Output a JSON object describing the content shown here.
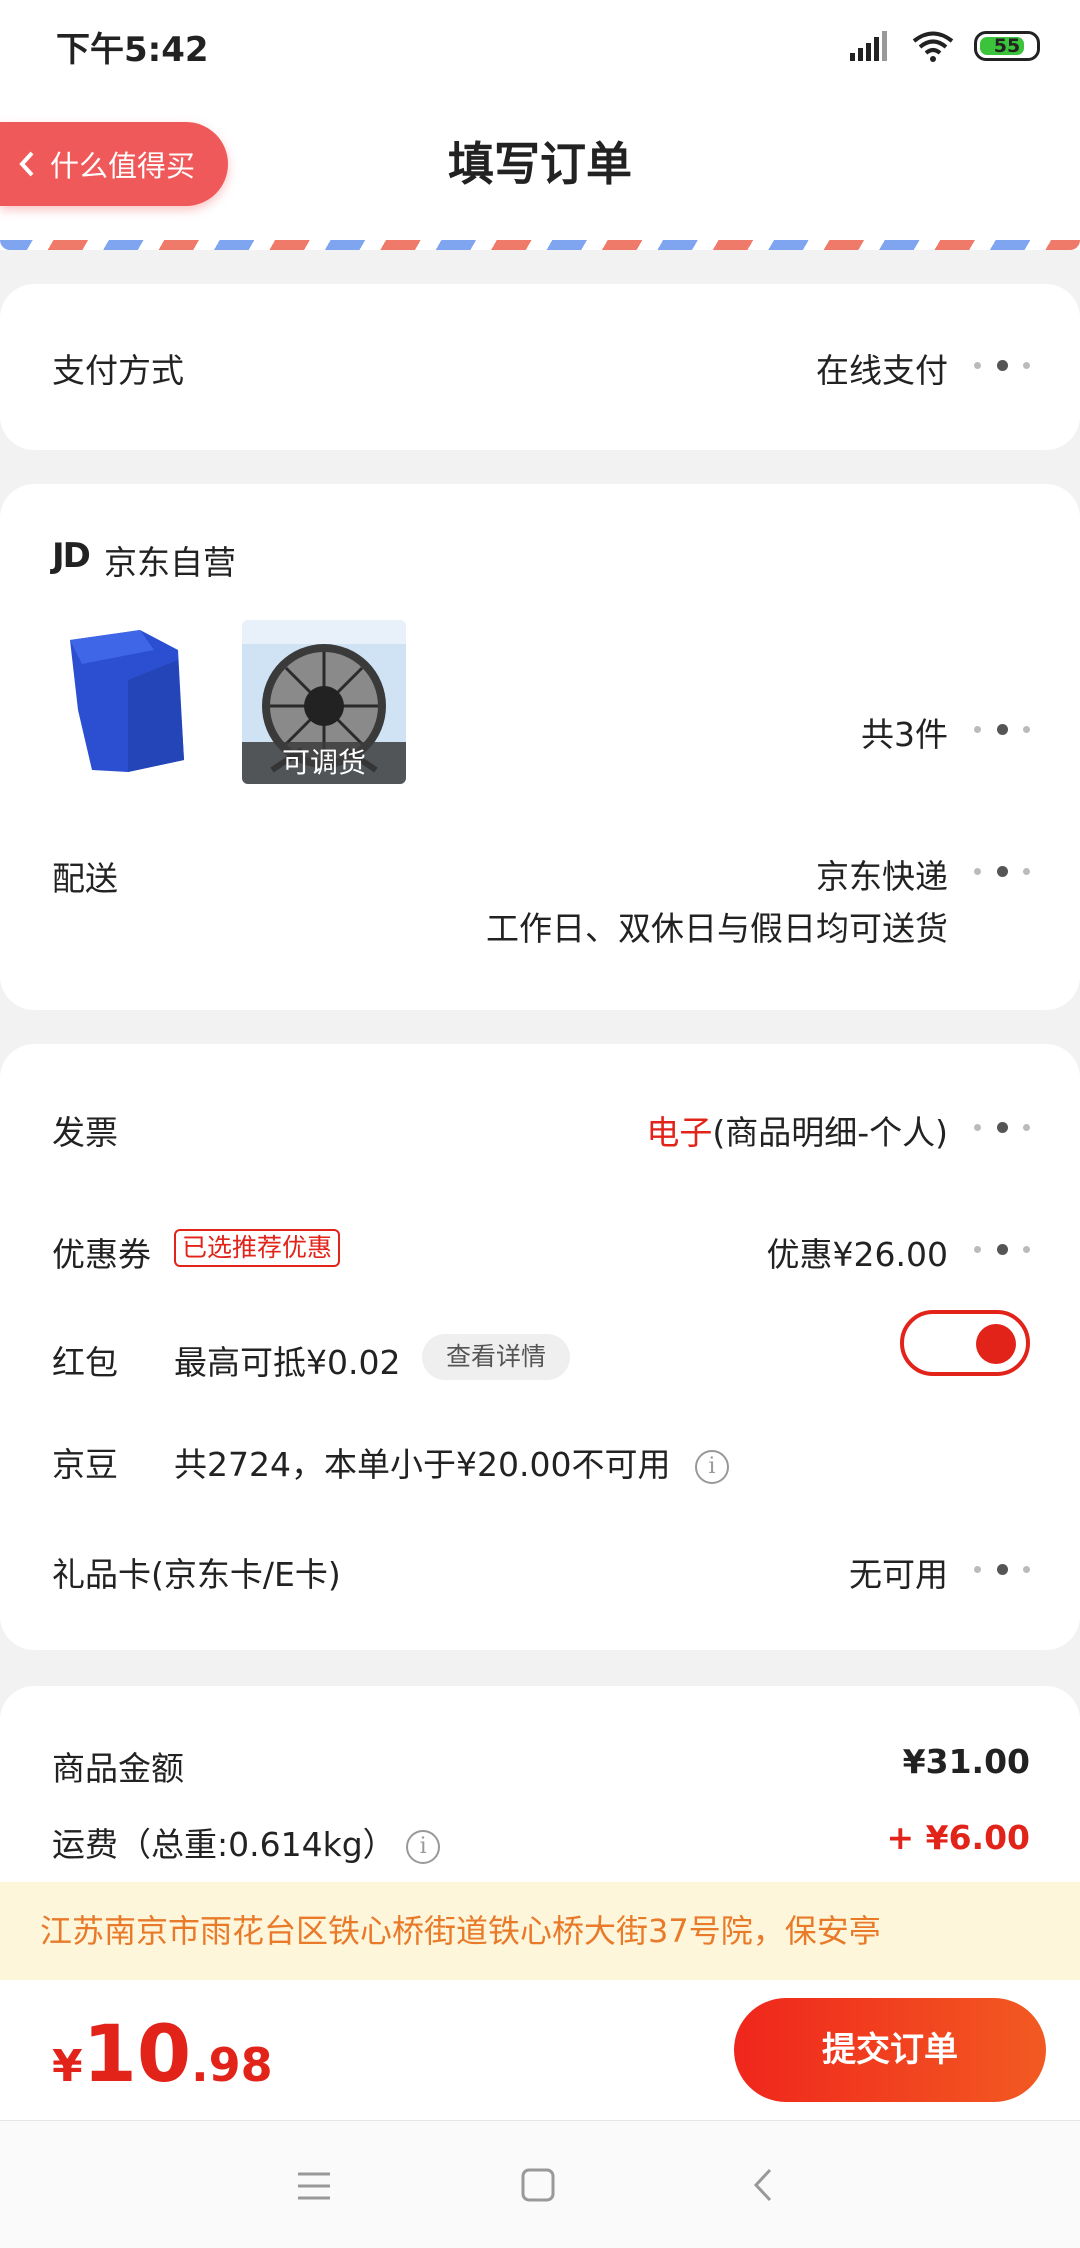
{
  "status_bar": {
    "time": "下午5:42",
    "battery": "55"
  },
  "header": {
    "title": "填写订单",
    "back_label": "什么值得买"
  },
  "payment": {
    "label": "支付方式",
    "value": "在线支付"
  },
  "store": {
    "logo": "JD",
    "name": "京东自营",
    "adjust_tag": "可调货",
    "count": "共3件",
    "delivery_label": "配送",
    "delivery_method": "京东快递",
    "delivery_note": "工作日、双休日与假日均可送货"
  },
  "invoice": {
    "label": "发票",
    "type": "电子",
    "detail": "(商品明细-个人)"
  },
  "coupon": {
    "label": "优惠券",
    "tag": "已选推荐优惠",
    "value": "优惠¥26.00"
  },
  "red_packet": {
    "label": "红包",
    "max_text": "最高可抵¥0.02",
    "detail_btn": "查看详情"
  },
  "beans": {
    "label": "京豆",
    "text": "共2724，本单小于¥20.00不可用"
  },
  "gift_card": {
    "label": "礼品卡(京东卡/E卡)",
    "value": "无可用"
  },
  "amounts": {
    "goods_label": "商品金额",
    "goods_value": "¥31.00",
    "shipping_label": "运费（总重:0.614kg）",
    "shipping_value": "+ ¥6.00"
  },
  "address": "江苏南京市雨花台区铁心桥街道铁心桥大街37号院，保安亭",
  "total": {
    "currency": "¥",
    "integer": "10",
    "decimal": ".98"
  },
  "submit_label": "提交订单",
  "colors": {
    "accent": "#e2231a",
    "address_bg": "#fdf6db",
    "address_text": "#e87a2a"
  }
}
